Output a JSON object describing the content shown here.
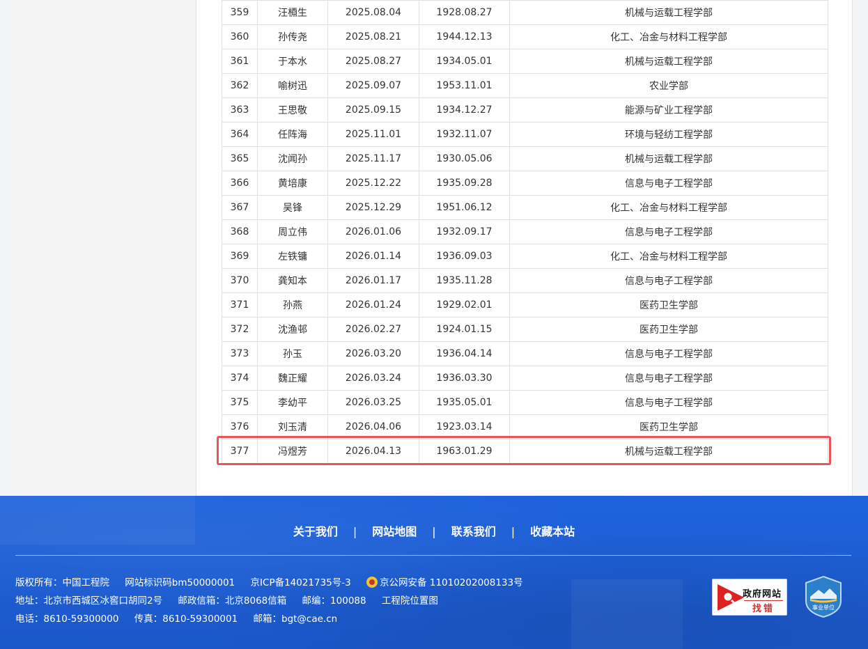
{
  "table": {
    "rows": [
      [
        "359",
        "汪槱生",
        "2025.08.04",
        "1928.08.27",
        "机械与运载工程学部"
      ],
      [
        "360",
        "孙传尧",
        "2025.08.21",
        "1944.12.13",
        "化工、冶金与材料工程学部"
      ],
      [
        "361",
        "于本水",
        "2025.08.27",
        "1934.05.01",
        "机械与运载工程学部"
      ],
      [
        "362",
        "喻树迅",
        "2025.09.07",
        "1953.11.01",
        "农业学部"
      ],
      [
        "363",
        "王思敬",
        "2025.09.15",
        "1934.12.27",
        "能源与矿业工程学部"
      ],
      [
        "364",
        "任阵海",
        "2025.11.01",
        "1932.11.07",
        "环境与轻纺工程学部"
      ],
      [
        "365",
        "沈闻孙",
        "2025.11.17",
        "1930.05.06",
        "机械与运载工程学部"
      ],
      [
        "366",
        "黄培康",
        "2025.12.22",
        "1935.09.28",
        "信息与电子工程学部"
      ],
      [
        "367",
        "吴锋",
        "2025.12.29",
        "1951.06.12",
        "化工、冶金与材料工程学部"
      ],
      [
        "368",
        "周立伟",
        "2026.01.06",
        "1932.09.17",
        "信息与电子工程学部"
      ],
      [
        "369",
        "左铁镛",
        "2026.01.14",
        "1936.09.03",
        "化工、冶金与材料工程学部"
      ],
      [
        "370",
        "龚知本",
        "2026.01.17",
        "1935.11.28",
        "信息与电子工程学部"
      ],
      [
        "371",
        "孙燕",
        "2026.01.24",
        "1929.02.01",
        "医药卫生学部"
      ],
      [
        "372",
        "沈渔邨",
        "2026.02.27",
        "1924.01.15",
        "医药卫生学部"
      ],
      [
        "373",
        "孙玉",
        "2026.03.20",
        "1936.04.14",
        "信息与电子工程学部"
      ],
      [
        "374",
        "魏正耀",
        "2026.03.24",
        "1936.03.30",
        "信息与电子工程学部"
      ],
      [
        "375",
        "李幼平",
        "2026.03.25",
        "1935.05.01",
        "信息与电子工程学部"
      ],
      [
        "376",
        "刘玉清",
        "2026.04.06",
        "1923.03.14",
        "医药卫生学部"
      ],
      [
        "377",
        "冯煜芳",
        "2026.04.13",
        "1963.01.29",
        "机械与运载工程学部"
      ]
    ],
    "highlight_color": "#e8545a"
  },
  "footer": {
    "links": [
      "关于我们",
      "网站地图",
      "联系我们",
      "收藏本站"
    ],
    "separator": "|",
    "line1": [
      "版权所有：中国工程院",
      "网站标识码bm50000001",
      "京ICP备14021735号-3",
      "京公网安备 11010202008133号"
    ],
    "line2": [
      "地址：北京市西城区冰窖口胡同2号",
      "邮政信箱：北京8068信箱",
      "邮编：100088",
      "工程院位置图"
    ],
    "line3": [
      "电话：8610-59300000",
      "传真：8610-59300001",
      "邮箱：bgt@cae.cn"
    ],
    "gov_badge": {
      "title": "政府网站",
      "sub": "找错"
    },
    "shiye_badge": "事业单位",
    "bg_color": "#1d5fd6"
  }
}
